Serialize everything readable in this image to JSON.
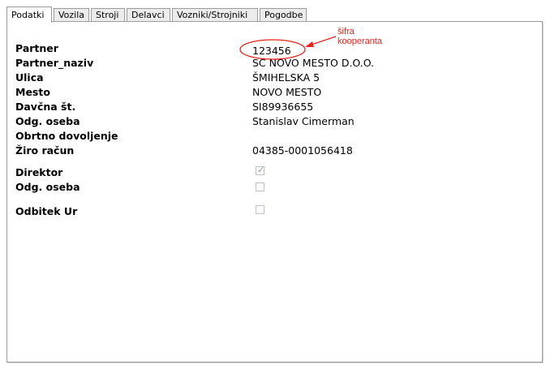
{
  "tabs": [
    {
      "label": "Podatki",
      "active": true
    },
    {
      "label": "Vozila",
      "active": false
    },
    {
      "label": "Stroji",
      "active": false
    },
    {
      "label": "Delavci",
      "active": false
    },
    {
      "label": "Vozniki/Strojniki",
      "active": false
    },
    {
      "label": "Pogodbe",
      "active": false
    }
  ],
  "fields": {
    "partner": {
      "label": "Partner",
      "value": "123456"
    },
    "partner_naziv": {
      "label": "Partner_naziv",
      "value": "SC NOVO MESTO D.O.O."
    },
    "ulica": {
      "label": "Ulica",
      "value": "ŠMIHELSKA 5"
    },
    "mesto": {
      "label": "Mesto",
      "value": "NOVO MESTO"
    },
    "davcna": {
      "label": "Davčna št.",
      "value": "SI89936655"
    },
    "odg_oseba": {
      "label": "Odg. oseba",
      "value": "Stanislav Cimerman"
    },
    "obrtno": {
      "label": "Obrtno dovoljenje",
      "value": ""
    },
    "ziro": {
      "label": "Žiro račun",
      "value": "04385-0001056418"
    }
  },
  "checkboxes": {
    "direktor": {
      "label": "Direktor",
      "checked": true
    },
    "odg_oseba": {
      "label": "Odg. oseba",
      "checked": false
    },
    "odbitek": {
      "label": "Odbitek Ur",
      "checked": false
    }
  },
  "annotation": {
    "line1": "šifra",
    "line2": "kooperanta",
    "color": "#e8231e"
  }
}
